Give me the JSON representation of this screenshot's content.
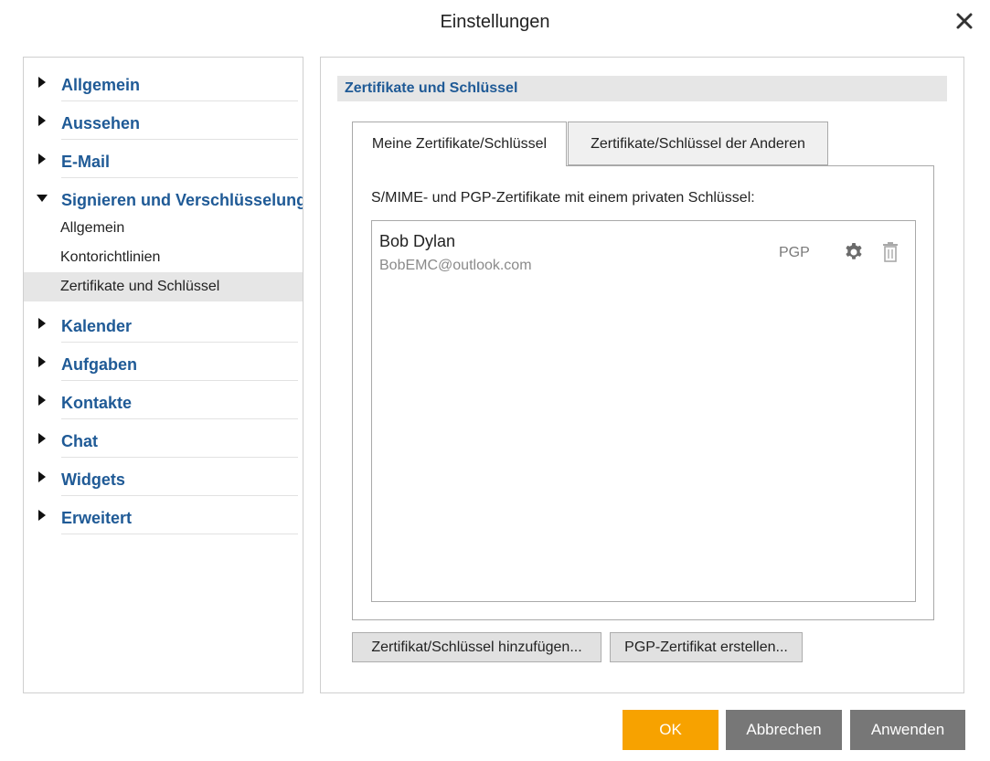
{
  "dialog": {
    "title": "Einstellungen",
    "close_icon": "close-icon"
  },
  "sidebar": {
    "sections": [
      {
        "label": "Allgemein",
        "expanded": false
      },
      {
        "label": "Aussehen",
        "expanded": false
      },
      {
        "label": "E-Mail",
        "expanded": false
      },
      {
        "label": "Signieren und Verschlüsselung",
        "expanded": true,
        "subitems": [
          {
            "label": "Allgemein",
            "selected": false
          },
          {
            "label": "Kontorichtlinien",
            "selected": false
          },
          {
            "label": "Zertifikate und Schlüssel",
            "selected": true
          }
        ]
      },
      {
        "label": "Kalender",
        "expanded": false
      },
      {
        "label": "Aufgaben",
        "expanded": false
      },
      {
        "label": "Kontakte",
        "expanded": false
      },
      {
        "label": "Chat",
        "expanded": false
      },
      {
        "label": "Widgets",
        "expanded": false
      },
      {
        "label": "Erweitert",
        "expanded": false
      }
    ]
  },
  "main": {
    "section_title": "Zertifikate und Schlüssel",
    "tabs": [
      {
        "label": "Meine Zertifikate/Schlüssel",
        "active": true
      },
      {
        "label": "Zertifikate/Schlüssel der Anderen",
        "active": false
      }
    ],
    "description": "S/MIME- und PGP-Zertifikate mit einem privaten Schlüssel:",
    "certificates": [
      {
        "name": "Bob Dylan",
        "email": "BobEMC@outlook.com",
        "type": "PGP"
      }
    ],
    "add_button": "Zertifikat/Schlüssel hinzufügen...",
    "create_pgp_button": "PGP-Zertifikat erstellen..."
  },
  "footer": {
    "ok": "OK",
    "cancel": "Abbrechen",
    "apply": "Anwenden"
  },
  "colors": {
    "accent": "#f7a200",
    "link_blue": "#1f5a96",
    "button_gray": "#777777"
  }
}
